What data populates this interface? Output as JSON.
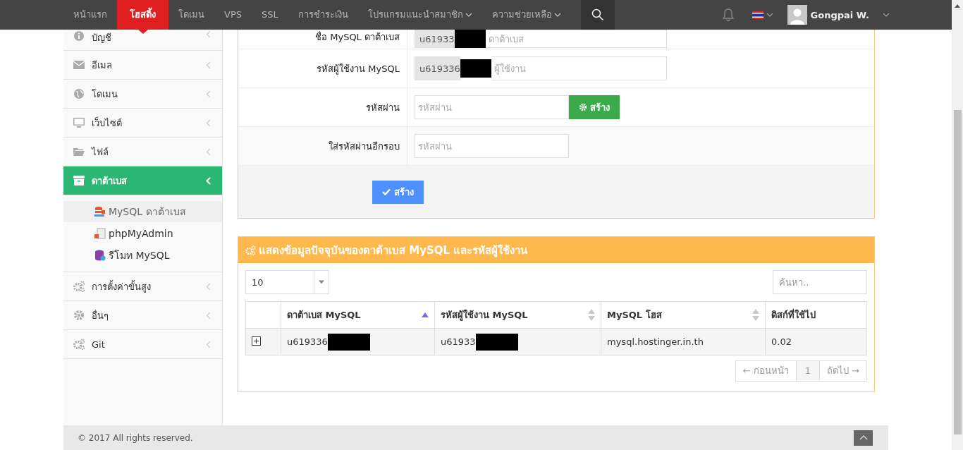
{
  "nav": {
    "items": [
      {
        "label": "หน้าแรก",
        "selected": false,
        "has_menu": false
      },
      {
        "label": "โฮสติ้ง",
        "selected": true,
        "has_menu": false
      },
      {
        "label": "โดเมน",
        "selected": false,
        "has_menu": false
      },
      {
        "label": "VPS",
        "selected": false,
        "has_menu": false
      },
      {
        "label": "SSL",
        "selected": false,
        "has_menu": false
      },
      {
        "label": "การชำระเงิน",
        "selected": false,
        "has_menu": false
      },
      {
        "label": "โปรแกรมแนะนำสมาชิก",
        "selected": false,
        "has_menu": true
      },
      {
        "label": "ความช่วยเหลือ",
        "selected": false,
        "has_menu": true
      }
    ],
    "user": {
      "name": "Gongpai W."
    }
  },
  "sidebar": {
    "items": [
      {
        "label": "บัญชี",
        "selected": false
      },
      {
        "label": "อีเมล",
        "selected": false
      },
      {
        "label": "โดเมน",
        "selected": false
      },
      {
        "label": "เว็บไซต์",
        "selected": false
      },
      {
        "label": "ไฟล์",
        "selected": false
      },
      {
        "label": "ดาต้าเบส",
        "selected": true,
        "children": [
          {
            "label": "MySQL ดาต้าเบส",
            "selected": true
          },
          {
            "label": "phpMyAdmin",
            "selected": false
          },
          {
            "label": "รีโมท MySQL",
            "selected": false
          }
        ]
      },
      {
        "label": "การตั้งค่าขั้นสูง",
        "selected": false
      },
      {
        "label": "อื่นๆ",
        "selected": false
      },
      {
        "label": "Git",
        "selected": false
      }
    ]
  },
  "form": {
    "rows": [
      {
        "kind": "prefixed",
        "label": "ชื่อ MySQL ดาต้าเบส",
        "prefix": "u61933",
        "redacted": true,
        "placeholder": "ดาต้าเบส"
      },
      {
        "kind": "prefixed",
        "label": "รหัสผู้ใช้งาน MySQL",
        "prefix": "u619336",
        "redacted": true,
        "placeholder": "ผู้ใช้งาน"
      },
      {
        "kind": "generate",
        "label": "รหัสผ่าน",
        "placeholder": "รหัสผ่าน",
        "button": "สร้าง"
      },
      {
        "kind": "password",
        "label": "ใส่รหัสผ่านอีกรอบ",
        "placeholder": "รหัสผ่าน"
      }
    ],
    "submit": "สร้าง"
  },
  "table_panel": {
    "title": "แสดงข้อมูลปัจจุบันของดาต้าเบส MySQL และรหัสผู้ใช้งาน",
    "page_length": "10",
    "search_placeholder": "ค้นหา..",
    "columns": [
      {
        "label": "ดาต้าเบส MySQL",
        "sortable": true,
        "sorted_ascending": true
      },
      {
        "label": "รหัสผู้ใช้งาน MySQL",
        "sortable": true,
        "sorted_ascending": false
      },
      {
        "label": "MySQL โฮส",
        "sortable": true,
        "sorted_ascending": false
      },
      {
        "label": "ดิสก์ที่ใช้ไป",
        "sortable": false
      }
    ],
    "rows": [
      {
        "expandable": true,
        "cells": [
          {
            "text": "u619336",
            "redacted": true
          },
          {
            "text": "u61933",
            "redacted": true
          },
          {
            "text": "mysql.hostinger.in.th",
            "redacted": false
          },
          {
            "text": "0.02",
            "redacted": false
          }
        ]
      }
    ],
    "pagination": {
      "prev": {
        "label": "← ก่อนหน้า",
        "disabled": true
      },
      "pages": [
        {
          "label": "1",
          "selected": true
        }
      ],
      "next": {
        "label": "ถัดไป →",
        "disabled": true
      }
    }
  },
  "footer": {
    "copyright": "© 2017 All rights reserved."
  }
}
